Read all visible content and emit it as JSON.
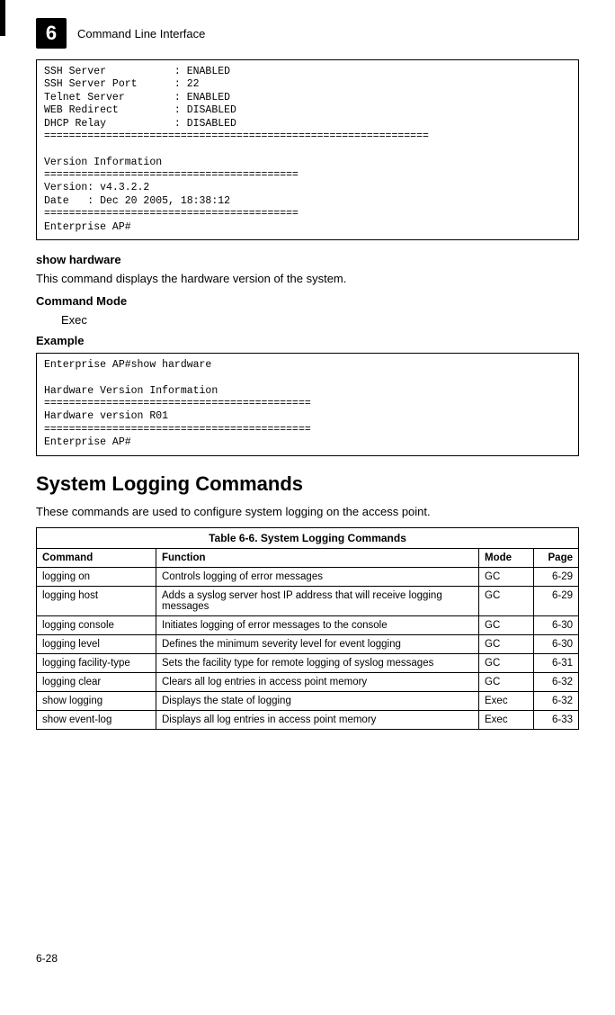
{
  "header": {
    "chapter_number": "6",
    "title": "Command Line Interface"
  },
  "codebox1": "SSH Server           : ENABLED\nSSH Server Port      : 22\nTelnet Server        : ENABLED\nWEB Redirect         : DISABLED\nDHCP Relay           : DISABLED\n==============================================================\n\nVersion Information\n=========================================\nVersion: v4.3.2.2\nDate   : Dec 20 2005, 18:38:12\n=========================================\nEnterprise AP#",
  "section1": {
    "title": "show hardware",
    "desc": "This command displays the hardware version of the system.",
    "mode_label": "Command Mode",
    "mode_value": "Exec",
    "example_label": "Example"
  },
  "codebox2": "Enterprise AP#show hardware\n\nHardware Version Information\n===========================================\nHardware version R01\n===========================================\nEnterprise AP#",
  "section2": {
    "title": "System Logging Commands",
    "desc": "These commands are used to configure system logging on the access point."
  },
  "table": {
    "caption": "Table 6-6. System Logging Commands",
    "headers": {
      "command": "Command",
      "function": "Function",
      "mode": "Mode",
      "page": "Page"
    },
    "rows": [
      {
        "command": "logging on",
        "function": "Controls logging of error messages",
        "mode": "GC",
        "page": "6-29"
      },
      {
        "command": "logging  host",
        "function": "Adds a syslog server host IP address that will receive logging messages",
        "mode": "GC",
        "page": "6-29"
      },
      {
        "command": "logging console",
        "function": "Initiates logging of error messages to the console",
        "mode": "GC",
        "page": "6-30"
      },
      {
        "command": "logging level",
        "function": "Defines the minimum severity level for event logging",
        "mode": "GC",
        "page": "6-30"
      },
      {
        "command": "logging facility-type",
        "function": "Sets the facility type for remote logging of syslog messages",
        "mode": "GC",
        "page": "6-31"
      },
      {
        "command": "logging clear",
        "function": "Clears all log entries in access point memory",
        "mode": "GC",
        "page": "6-32"
      },
      {
        "command": "show logging",
        "function": "Displays the state of logging",
        "mode": "Exec",
        "page": "6-32"
      },
      {
        "command": "show event-log",
        "function": "Displays all log entries in access point memory",
        "mode": "Exec",
        "page": "6-33"
      }
    ]
  },
  "footer": {
    "page_number": "6-28"
  }
}
